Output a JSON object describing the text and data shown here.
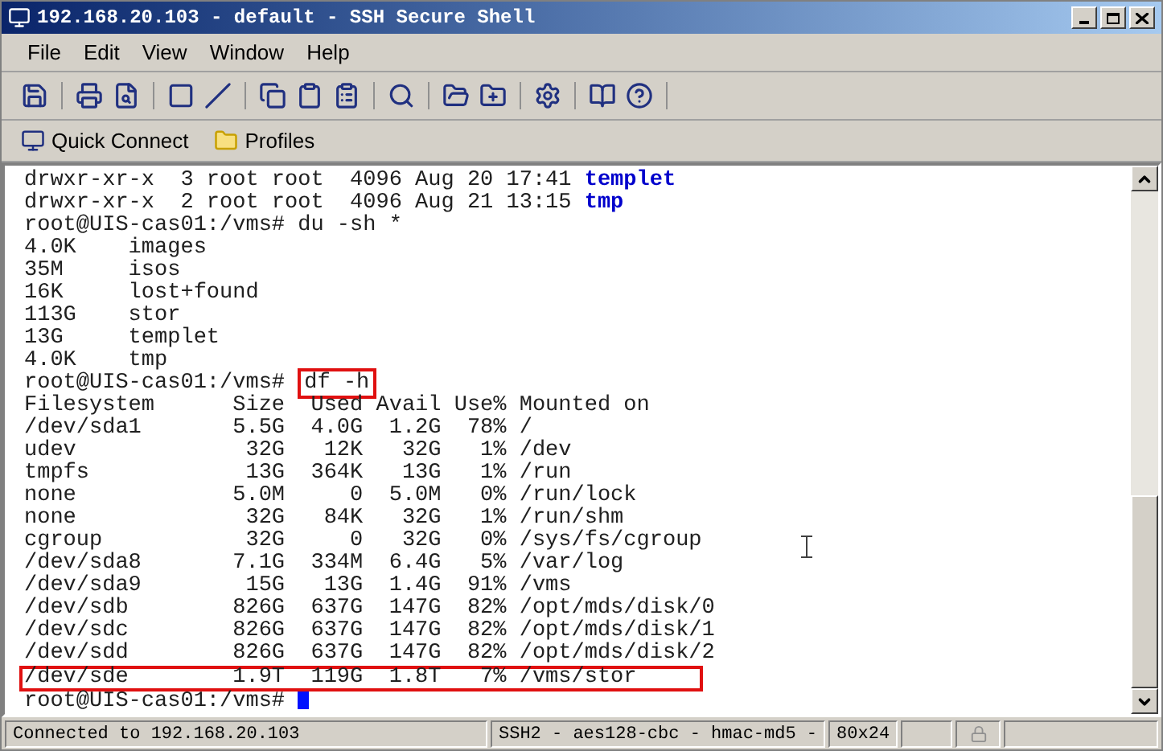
{
  "window": {
    "title": "192.168.20.103 - default - SSH Secure Shell"
  },
  "menu": [
    "File",
    "Edit",
    "View",
    "Window",
    "Help"
  ],
  "quick_bar": [
    {
      "kind": "connect",
      "label": "Quick Connect"
    },
    {
      "kind": "profiles",
      "label": "Profiles"
    }
  ],
  "terminal": {
    "lines": [
      {
        "boxed": false,
        "segments": [
          {
            "kind": "plain",
            "text": "drwxr-xr-x  3 root root  4096 Aug 20 17:41 "
          },
          {
            "kind": "dir",
            "text": "templet"
          }
        ]
      },
      {
        "boxed": false,
        "segments": [
          {
            "kind": "plain",
            "text": "drwxr-xr-x  2 root root  4096 Aug 21 13:15 "
          },
          {
            "kind": "dir",
            "text": "tmp"
          }
        ]
      },
      {
        "boxed": false,
        "segments": [
          {
            "kind": "plain",
            "text": "root@UIS-cas01:/vms# du -sh *"
          }
        ]
      },
      {
        "boxed": false,
        "segments": [
          {
            "kind": "plain",
            "text": "4.0K    images"
          }
        ]
      },
      {
        "boxed": false,
        "segments": [
          {
            "kind": "plain",
            "text": "35M     isos"
          }
        ]
      },
      {
        "boxed": false,
        "segments": [
          {
            "kind": "plain",
            "text": "16K     lost+found"
          }
        ]
      },
      {
        "boxed": false,
        "segments": [
          {
            "kind": "plain",
            "text": "113G    stor"
          }
        ]
      },
      {
        "boxed": false,
        "segments": [
          {
            "kind": "plain",
            "text": "13G     templet"
          }
        ]
      },
      {
        "boxed": false,
        "segments": [
          {
            "kind": "plain",
            "text": "4.0K    tmp"
          }
        ]
      },
      {
        "boxed": false,
        "segments": [
          {
            "kind": "plain",
            "text": "root@UIS-cas01:/vms# "
          },
          {
            "kind": "boxed",
            "text": "df -h"
          }
        ]
      },
      {
        "boxed": false,
        "segments": [
          {
            "kind": "plain",
            "text": "Filesystem      Size  Used Avail Use% Mounted on"
          }
        ]
      },
      {
        "boxed": false,
        "segments": [
          {
            "kind": "plain",
            "text": "/dev/sda1       5.5G  4.0G  1.2G  78% /"
          }
        ]
      },
      {
        "boxed": false,
        "segments": [
          {
            "kind": "plain",
            "text": "udev             32G   12K   32G   1% /dev"
          }
        ]
      },
      {
        "boxed": false,
        "segments": [
          {
            "kind": "plain",
            "text": "tmpfs            13G  364K   13G   1% /run"
          }
        ]
      },
      {
        "boxed": false,
        "segments": [
          {
            "kind": "plain",
            "text": "none            5.0M     0  5.0M   0% /run/lock"
          }
        ]
      },
      {
        "boxed": false,
        "segments": [
          {
            "kind": "plain",
            "text": "none             32G   84K   32G   1% /run/shm"
          }
        ]
      },
      {
        "boxed": false,
        "segments": [
          {
            "kind": "plain",
            "text": "cgroup           32G     0   32G   0% /sys/fs/cgroup"
          }
        ]
      },
      {
        "boxed": false,
        "segments": [
          {
            "kind": "plain",
            "text": "/dev/sda8       7.1G  334M  6.4G   5% /var/log"
          }
        ]
      },
      {
        "boxed": false,
        "segments": [
          {
            "kind": "plain",
            "text": "/dev/sda9        15G   13G  1.4G  91% /vms"
          }
        ]
      },
      {
        "boxed": false,
        "segments": [
          {
            "kind": "plain",
            "text": "/dev/sdb        826G  637G  147G  82% /opt/mds/disk/0"
          }
        ]
      },
      {
        "boxed": false,
        "segments": [
          {
            "kind": "plain",
            "text": "/dev/sdc        826G  637G  147G  82% /opt/mds/disk/1"
          }
        ]
      },
      {
        "boxed": false,
        "segments": [
          {
            "kind": "plain",
            "text": "/dev/sdd        826G  637G  147G  82% /opt/mds/disk/2"
          }
        ]
      },
      {
        "boxed": true,
        "segments": [
          {
            "kind": "plain",
            "text": "/dev/sde        1.9T  119G  1.8T   7% /vms/stor"
          }
        ]
      },
      {
        "boxed": false,
        "cursor": true,
        "segments": [
          {
            "kind": "plain",
            "text": "root@UIS-cas01:/vms# "
          }
        ]
      }
    ]
  },
  "status_bar": [
    "Connected to 192.168.20.103",
    "SSH2 - aes128-cbc - hmac-md5 - ",
    "80x24"
  ]
}
